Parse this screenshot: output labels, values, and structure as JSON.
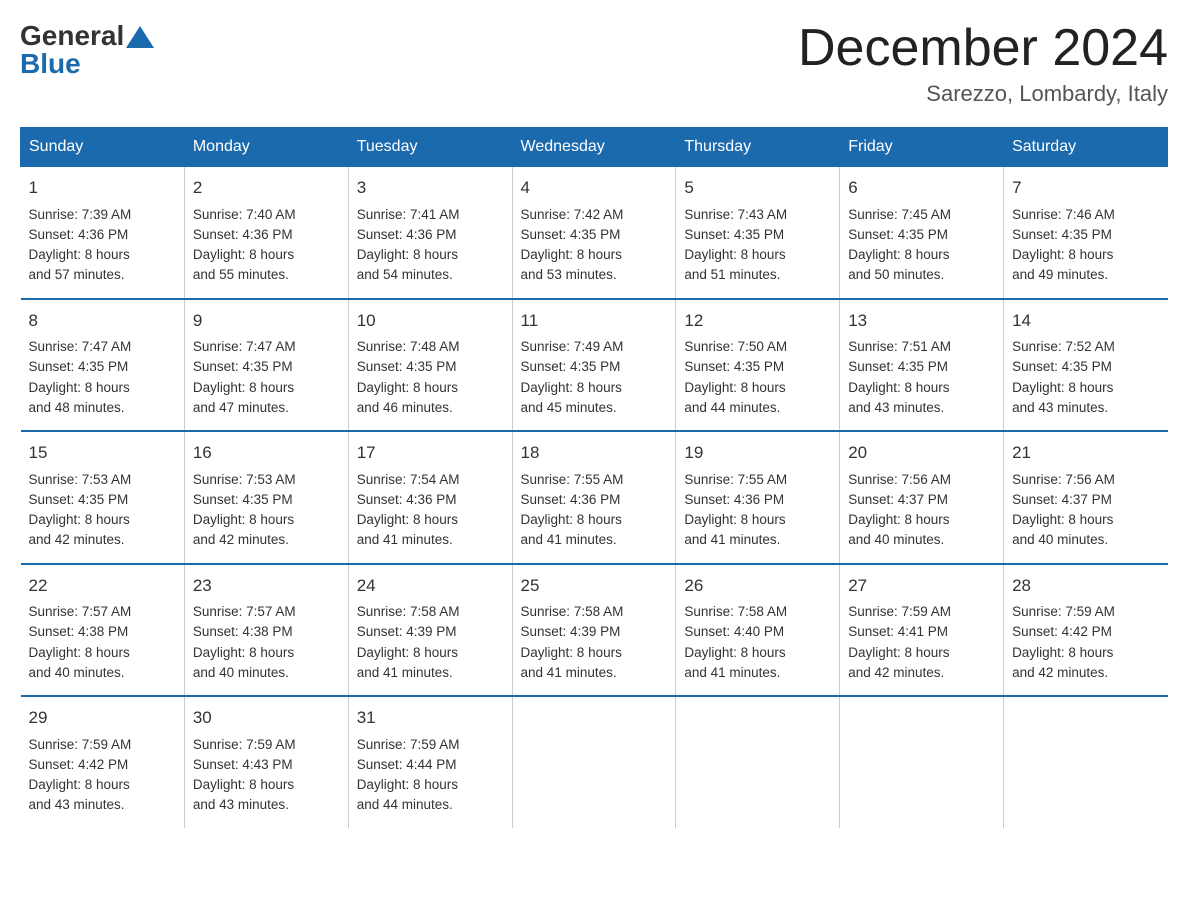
{
  "header": {
    "logo_general": "General",
    "logo_blue": "Blue",
    "month_title": "December 2024",
    "location": "Sarezzo, Lombardy, Italy"
  },
  "days_of_week": [
    "Sunday",
    "Monday",
    "Tuesday",
    "Wednesday",
    "Thursday",
    "Friday",
    "Saturday"
  ],
  "weeks": [
    [
      {
        "day": "1",
        "sunrise": "7:39 AM",
        "sunset": "4:36 PM",
        "daylight": "8 hours and 57 minutes."
      },
      {
        "day": "2",
        "sunrise": "7:40 AM",
        "sunset": "4:36 PM",
        "daylight": "8 hours and 55 minutes."
      },
      {
        "day": "3",
        "sunrise": "7:41 AM",
        "sunset": "4:36 PM",
        "daylight": "8 hours and 54 minutes."
      },
      {
        "day": "4",
        "sunrise": "7:42 AM",
        "sunset": "4:35 PM",
        "daylight": "8 hours and 53 minutes."
      },
      {
        "day": "5",
        "sunrise": "7:43 AM",
        "sunset": "4:35 PM",
        "daylight": "8 hours and 51 minutes."
      },
      {
        "day": "6",
        "sunrise": "7:45 AM",
        "sunset": "4:35 PM",
        "daylight": "8 hours and 50 minutes."
      },
      {
        "day": "7",
        "sunrise": "7:46 AM",
        "sunset": "4:35 PM",
        "daylight": "8 hours and 49 minutes."
      }
    ],
    [
      {
        "day": "8",
        "sunrise": "7:47 AM",
        "sunset": "4:35 PM",
        "daylight": "8 hours and 48 minutes."
      },
      {
        "day": "9",
        "sunrise": "7:47 AM",
        "sunset": "4:35 PM",
        "daylight": "8 hours and 47 minutes."
      },
      {
        "day": "10",
        "sunrise": "7:48 AM",
        "sunset": "4:35 PM",
        "daylight": "8 hours and 46 minutes."
      },
      {
        "day": "11",
        "sunrise": "7:49 AM",
        "sunset": "4:35 PM",
        "daylight": "8 hours and 45 minutes."
      },
      {
        "day": "12",
        "sunrise": "7:50 AM",
        "sunset": "4:35 PM",
        "daylight": "8 hours and 44 minutes."
      },
      {
        "day": "13",
        "sunrise": "7:51 AM",
        "sunset": "4:35 PM",
        "daylight": "8 hours and 43 minutes."
      },
      {
        "day": "14",
        "sunrise": "7:52 AM",
        "sunset": "4:35 PM",
        "daylight": "8 hours and 43 minutes."
      }
    ],
    [
      {
        "day": "15",
        "sunrise": "7:53 AM",
        "sunset": "4:35 PM",
        "daylight": "8 hours and 42 minutes."
      },
      {
        "day": "16",
        "sunrise": "7:53 AM",
        "sunset": "4:35 PM",
        "daylight": "8 hours and 42 minutes."
      },
      {
        "day": "17",
        "sunrise": "7:54 AM",
        "sunset": "4:36 PM",
        "daylight": "8 hours and 41 minutes."
      },
      {
        "day": "18",
        "sunrise": "7:55 AM",
        "sunset": "4:36 PM",
        "daylight": "8 hours and 41 minutes."
      },
      {
        "day": "19",
        "sunrise": "7:55 AM",
        "sunset": "4:36 PM",
        "daylight": "8 hours and 41 minutes."
      },
      {
        "day": "20",
        "sunrise": "7:56 AM",
        "sunset": "4:37 PM",
        "daylight": "8 hours and 40 minutes."
      },
      {
        "day": "21",
        "sunrise": "7:56 AM",
        "sunset": "4:37 PM",
        "daylight": "8 hours and 40 minutes."
      }
    ],
    [
      {
        "day": "22",
        "sunrise": "7:57 AM",
        "sunset": "4:38 PM",
        "daylight": "8 hours and 40 minutes."
      },
      {
        "day": "23",
        "sunrise": "7:57 AM",
        "sunset": "4:38 PM",
        "daylight": "8 hours and 40 minutes."
      },
      {
        "day": "24",
        "sunrise": "7:58 AM",
        "sunset": "4:39 PM",
        "daylight": "8 hours and 41 minutes."
      },
      {
        "day": "25",
        "sunrise": "7:58 AM",
        "sunset": "4:39 PM",
        "daylight": "8 hours and 41 minutes."
      },
      {
        "day": "26",
        "sunrise": "7:58 AM",
        "sunset": "4:40 PM",
        "daylight": "8 hours and 41 minutes."
      },
      {
        "day": "27",
        "sunrise": "7:59 AM",
        "sunset": "4:41 PM",
        "daylight": "8 hours and 42 minutes."
      },
      {
        "day": "28",
        "sunrise": "7:59 AM",
        "sunset": "4:42 PM",
        "daylight": "8 hours and 42 minutes."
      }
    ],
    [
      {
        "day": "29",
        "sunrise": "7:59 AM",
        "sunset": "4:42 PM",
        "daylight": "8 hours and 43 minutes."
      },
      {
        "day": "30",
        "sunrise": "7:59 AM",
        "sunset": "4:43 PM",
        "daylight": "8 hours and 43 minutes."
      },
      {
        "day": "31",
        "sunrise": "7:59 AM",
        "sunset": "4:44 PM",
        "daylight": "8 hours and 44 minutes."
      },
      null,
      null,
      null,
      null
    ]
  ],
  "labels": {
    "sunrise": "Sunrise:",
    "sunset": "Sunset:",
    "daylight": "Daylight:"
  }
}
